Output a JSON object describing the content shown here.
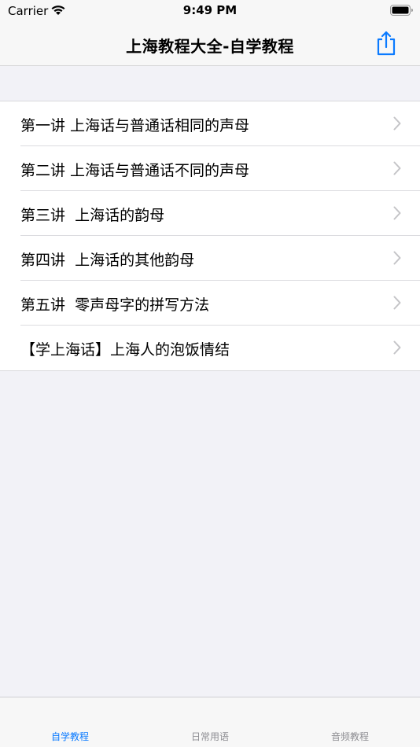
{
  "status": {
    "carrier": "Carrier",
    "time": "9:49 PM"
  },
  "nav": {
    "title": "上海教程大全-自学教程"
  },
  "lessons": [
    {
      "label": "第一讲 上海话与普通话相同的声母"
    },
    {
      "label": "第二讲 上海话与普通话不同的声母"
    },
    {
      "label": "第三讲  上海话的韵母"
    },
    {
      "label": "第四讲  上海话的其他韵母"
    },
    {
      "label": "第五讲  零声母字的拼写方法"
    },
    {
      "label": "【学上海话】上海人的泡饭情结"
    }
  ],
  "tabs": [
    {
      "label": "自学教程",
      "active": true
    },
    {
      "label": "日常用语",
      "active": false
    },
    {
      "label": "音频教程",
      "active": false
    }
  ],
  "colors": {
    "accent": "#0a7aff",
    "inactive": "#8e8e93"
  },
  "icons": {
    "share": "share-icon",
    "chevron": "chevron-right-icon",
    "wifi": "wifi-icon",
    "battery": "battery-icon"
  }
}
